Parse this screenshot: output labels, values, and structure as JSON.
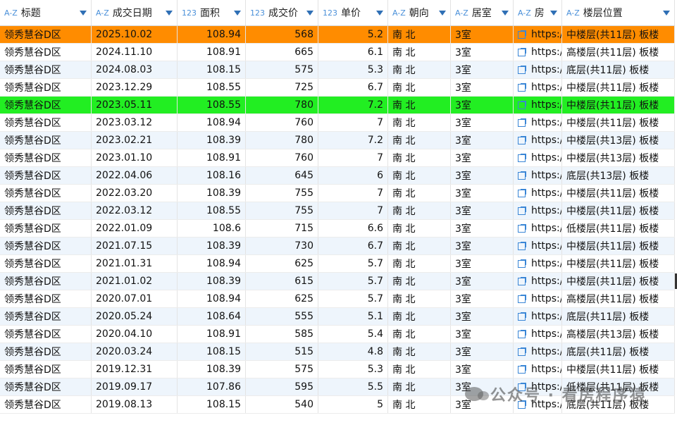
{
  "columns": [
    {
      "type": "A-Z",
      "label": "标题"
    },
    {
      "type": "A-Z",
      "label": "成交日期"
    },
    {
      "type": "123",
      "label": "面积"
    },
    {
      "type": "123",
      "label": "成交价"
    },
    {
      "type": "123",
      "label": "单价"
    },
    {
      "type": "A-Z",
      "label": "朝向"
    },
    {
      "type": "A-Z",
      "label": "居室"
    },
    {
      "type": "A-Z",
      "label": "房"
    },
    {
      "type": "A-Z",
      "label": "楼层位置"
    }
  ],
  "rows": [
    {
      "title": "领秀慧谷D区",
      "date": "2025.10.02",
      "area": "108.94",
      "price": "568",
      "unit": "5.2",
      "orient": "南 北",
      "rooms": "3室",
      "link": "https://",
      "floor": "中楼层(共11层) 板楼",
      "highlight": "orange"
    },
    {
      "title": "领秀慧谷D区",
      "date": "2024.11.10",
      "area": "108.91",
      "price": "665",
      "unit": "6.1",
      "orient": "南 北",
      "rooms": "3室",
      "link": "https://",
      "floor": "高楼层(共11层) 板楼"
    },
    {
      "title": "领秀慧谷D区",
      "date": "2024.08.03",
      "area": "108.15",
      "price": "575",
      "unit": "5.3",
      "orient": "南 北",
      "rooms": "3室",
      "link": "https://",
      "floor": "底层(共11层) 板楼"
    },
    {
      "title": "领秀慧谷D区",
      "date": "2023.12.29",
      "area": "108.55",
      "price": "725",
      "unit": "6.7",
      "orient": "南 北",
      "rooms": "3室",
      "link": "https://",
      "floor": "中楼层(共11层) 板楼"
    },
    {
      "title": "领秀慧谷D区",
      "date": "2023.05.11",
      "area": "108.55",
      "price": "780",
      "unit": "7.2",
      "orient": "南 北",
      "rooms": "3室",
      "link": "https://",
      "floor": "中楼层(共11层) 板楼",
      "highlight": "green"
    },
    {
      "title": "领秀慧谷D区",
      "date": "2023.03.12",
      "area": "108.94",
      "price": "760",
      "unit": "7",
      "orient": "南 北",
      "rooms": "3室",
      "link": "https://",
      "floor": "中楼层(共11层) 板楼"
    },
    {
      "title": "领秀慧谷D区",
      "date": "2023.02.21",
      "area": "108.39",
      "price": "780",
      "unit": "7.2",
      "orient": "南 北",
      "rooms": "3室",
      "link": "https://",
      "floor": "中楼层(共13层) 板楼"
    },
    {
      "title": "领秀慧谷D区",
      "date": "2023.01.10",
      "area": "108.91",
      "price": "760",
      "unit": "7",
      "orient": "南 北",
      "rooms": "3室",
      "link": "https://",
      "floor": "中楼层(共13层) 板楼"
    },
    {
      "title": "领秀慧谷D区",
      "date": "2022.04.06",
      "area": "108.16",
      "price": "645",
      "unit": "6",
      "orient": "南 北",
      "rooms": "3室",
      "link": "https://",
      "floor": "底层(共13层) 板楼"
    },
    {
      "title": "领秀慧谷D区",
      "date": "2022.03.20",
      "area": "108.39",
      "price": "755",
      "unit": "7",
      "orient": "南 北",
      "rooms": "3室",
      "link": "https://",
      "floor": "中楼层(共11层) 板楼"
    },
    {
      "title": "领秀慧谷D区",
      "date": "2022.03.12",
      "area": "108.55",
      "price": "755",
      "unit": "7",
      "orient": "南 北",
      "rooms": "3室",
      "link": "https://",
      "floor": "中楼层(共11层) 板楼"
    },
    {
      "title": "领秀慧谷D区",
      "date": "2022.01.09",
      "area": "108.6",
      "price": "715",
      "unit": "6.6",
      "orient": "南 北",
      "rooms": "3室",
      "link": "https://",
      "floor": "低楼层(共11层) 板楼"
    },
    {
      "title": "领秀慧谷D区",
      "date": "2021.07.15",
      "area": "108.39",
      "price": "730",
      "unit": "6.7",
      "orient": "南 北",
      "rooms": "3室",
      "link": "https://",
      "floor": "中楼层(共11层) 板楼"
    },
    {
      "title": "领秀慧谷D区",
      "date": "2021.01.31",
      "area": "108.94",
      "price": "625",
      "unit": "5.7",
      "orient": "南 北",
      "rooms": "3室",
      "link": "https://",
      "floor": "中楼层(共11层) 板楼"
    },
    {
      "title": "领秀慧谷D区",
      "date": "2021.01.02",
      "area": "108.39",
      "price": "615",
      "unit": "5.7",
      "orient": "南 北",
      "rooms": "3室",
      "link": "https://",
      "floor": "中楼层(共11层) 板楼"
    },
    {
      "title": "领秀慧谷D区",
      "date": "2020.07.01",
      "area": "108.94",
      "price": "625",
      "unit": "5.7",
      "orient": "南 北",
      "rooms": "3室",
      "link": "https://",
      "floor": "高楼层(共11层) 板楼"
    },
    {
      "title": "领秀慧谷D区",
      "date": "2020.05.24",
      "area": "108.64",
      "price": "555",
      "unit": "5.1",
      "orient": "南 北",
      "rooms": "3室",
      "link": "https://",
      "floor": "底层(共11层) 板楼"
    },
    {
      "title": "领秀慧谷D区",
      "date": "2020.04.10",
      "area": "108.91",
      "price": "585",
      "unit": "5.4",
      "orient": "南 北",
      "rooms": "3室",
      "link": "https://",
      "floor": "高楼层(共13层) 板楼"
    },
    {
      "title": "领秀慧谷D区",
      "date": "2020.03.24",
      "area": "108.15",
      "price": "515",
      "unit": "4.8",
      "orient": "南 北",
      "rooms": "3室",
      "link": "https://",
      "floor": "底层(共11层) 板楼"
    },
    {
      "title": "领秀慧谷D区",
      "date": "2019.12.31",
      "area": "108.39",
      "price": "575",
      "unit": "5.3",
      "orient": "南 北",
      "rooms": "3室",
      "link": "https://",
      "floor": "中楼层(共11层) 板楼"
    },
    {
      "title": "领秀慧谷D区",
      "date": "2019.09.17",
      "area": "107.86",
      "price": "595",
      "unit": "5.5",
      "orient": "南 北",
      "rooms": "3室",
      "link": "https://",
      "floor": "低楼层(共11层) 板楼"
    },
    {
      "title": "领秀慧谷D区",
      "date": "2019.08.13",
      "area": "108.15",
      "price": "540",
      "unit": "5",
      "orient": "南 北",
      "rooms": "3室",
      "link": "https://",
      "floor": "底层(共11层) 板楼"
    }
  ],
  "colors": {
    "highlight_orange": "#ff8c00",
    "highlight_green": "#22ee22",
    "alt_row": "#eef5fc",
    "type_icon": "#4a90d9"
  },
  "watermark": {
    "text": "公众号 · 看房程序猿"
  }
}
